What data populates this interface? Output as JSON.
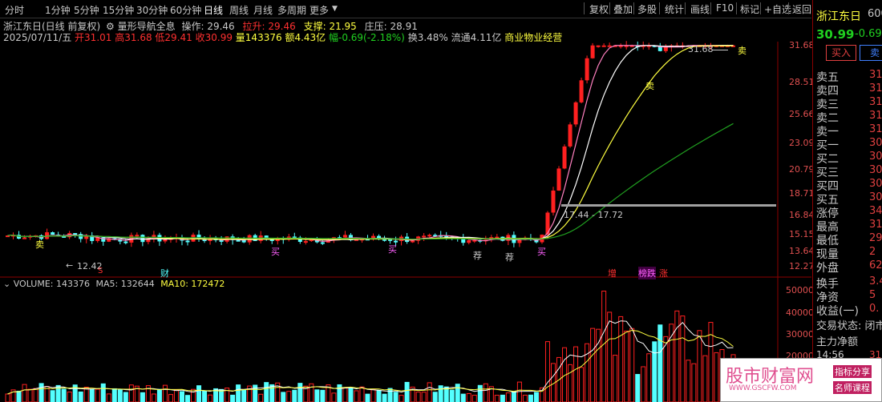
{
  "toolbar": {
    "periods": [
      "分时",
      "1分钟",
      "5分钟",
      "15分钟",
      "30分钟",
      "60分钟",
      "日线",
      "周线",
      "月线",
      "多周期",
      "更多"
    ],
    "active_period": "日线",
    "buttons": [
      "复权",
      "叠加",
      "多股",
      "统计",
      "画线",
      "F10",
      "标记",
      "+自选",
      "返回"
    ]
  },
  "info": {
    "stock_title": "浙江东日(日线 前复权)",
    "formula_name": "量形导航全息",
    "op_label": "操作:",
    "op_value": "29.46",
    "lift_label": "拉升:",
    "lift_value": "29.46",
    "support_label": "支撑:",
    "support_value": "21.95",
    "zhuang_label": "庄压:",
    "zhuang_value": "28.91",
    "date": "2025/07/11/五",
    "open": "开31.01",
    "high": "高31.68",
    "low": "低29.41",
    "close": "收30.99",
    "volume": "量143376",
    "amount": "额4.43亿",
    "change": "幅-0.69(-2.18%)",
    "turnover": "换3.48%",
    "float": "流通4.11亿",
    "industry": "商业物业经营"
  },
  "price_axis": [
    "31.68",
    "28.51",
    "25.66",
    "23.09",
    "20.79",
    "18.71",
    "16.84",
    "15.15",
    "13.64",
    "12.27"
  ],
  "annotations": {
    "high_mark": "31.68",
    "low_mark": "12.42",
    "range_mark": "17.44 - 17.72",
    "sell_label": "卖",
    "buy_labels": [
      "买",
      "买",
      "买"
    ],
    "rec_labels": [
      "荐",
      "荐"
    ],
    "bottom_markers": [
      "S",
      "财",
      "增",
      "榜跌",
      "涨"
    ]
  },
  "volume_panel": {
    "vol_label": "VOLUME: 143376",
    "ma5_label": "MA5: 132644",
    "ma10_label": "MA10: 172472",
    "axis": [
      "50000",
      "40000",
      "30000",
      "20000"
    ]
  },
  "right_panel": {
    "name": "浙江东日",
    "code": "600",
    "price": "30.99",
    "chg": "-0.69",
    "buy_btn": "买入",
    "sell_btn": "卖",
    "order_rows": [
      {
        "label": "卖五",
        "val": "31"
      },
      {
        "label": "卖四",
        "val": "31"
      },
      {
        "label": "卖三",
        "val": "31"
      },
      {
        "label": "卖二",
        "val": "31"
      },
      {
        "label": "卖一",
        "val": "31"
      },
      {
        "label": "买一",
        "val": "30"
      },
      {
        "label": "买二",
        "val": "30"
      },
      {
        "label": "买三",
        "val": "30"
      },
      {
        "label": "买四",
        "val": "30"
      },
      {
        "label": "买五",
        "val": "30"
      }
    ],
    "stat_rows": [
      {
        "label": "涨停",
        "val": "34"
      },
      {
        "label": "最高",
        "val": "31"
      },
      {
        "label": "最低",
        "val": "29"
      },
      {
        "label": "现量",
        "val": "2"
      },
      {
        "label": "外盘",
        "val": "62"
      }
    ],
    "extra_rows": [
      {
        "label": "换手",
        "val": "3.4"
      },
      {
        "label": "净资",
        "val": "5"
      },
      {
        "label": "收益(一)",
        "val": "0."
      }
    ],
    "trade_state": "交易状态: 闭市",
    "main_net": "主力净额",
    "time": "14:56",
    "time_val": "31"
  },
  "watermark": {
    "title": "股市财富网",
    "url": "WWW.GSCFW.COM",
    "tag1": "指标分享",
    "tag2": "名师课程"
  },
  "colors": {
    "up": "#ff2020",
    "down": "#54ffff",
    "ma_yellow": "#ffff40",
    "ma_white": "#ffffff",
    "ma_green": "#20a020",
    "pink": "#ff80c0"
  }
}
